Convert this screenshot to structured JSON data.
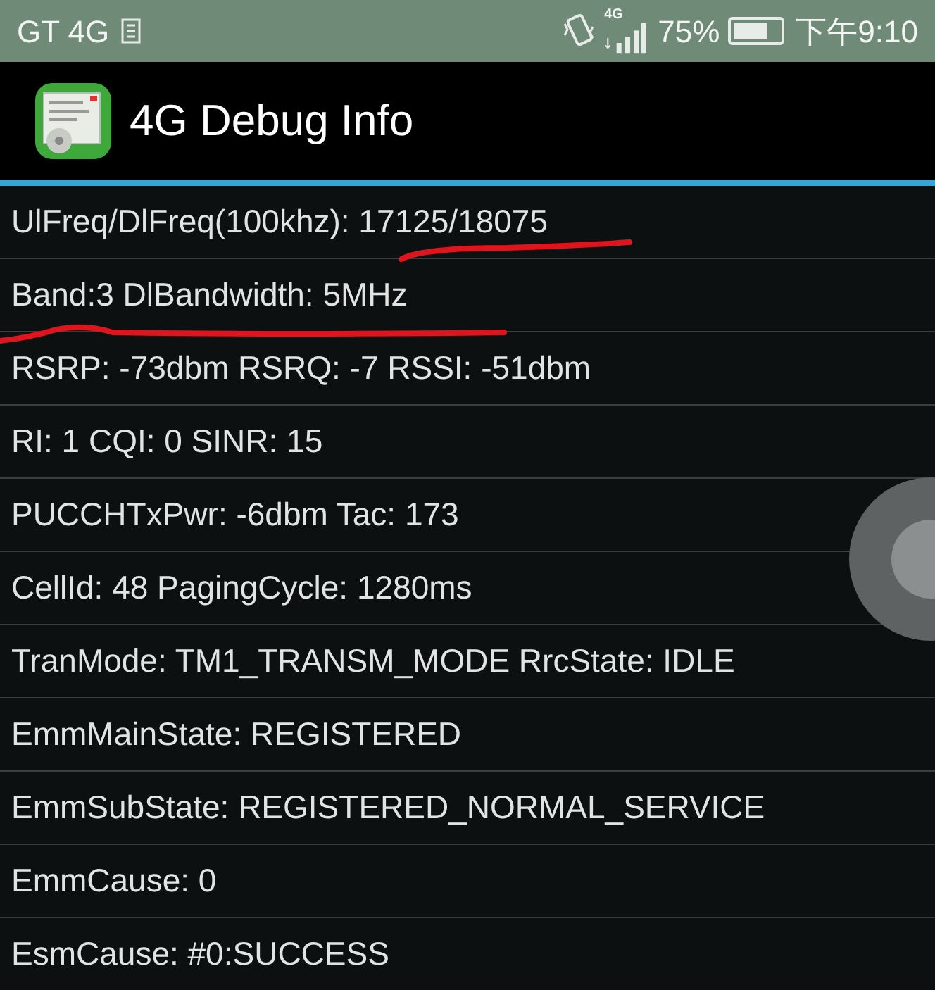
{
  "status_bar": {
    "carrier": "GT 4G",
    "network": "4G",
    "battery": "75%",
    "time": "下午9:10"
  },
  "action_bar": {
    "title": "4G Debug Info"
  },
  "rows": [
    {
      "text": "UlFreq/DlFreq(100khz): 17125/18075"
    },
    {
      "text": "Band:3 DlBandwidth: 5MHz"
    },
    {
      "text": "RSRP: -73dbm RSRQ: -7 RSSI: -51dbm"
    },
    {
      "text": "RI: 1 CQI: 0 SINR: 15"
    },
    {
      "text": "PUCCHTxPwr: -6dbm Tac: 173"
    },
    {
      "text": "CellId: 48 PagingCycle: 1280ms"
    },
    {
      "text": "TranMode: TM1_TRANSM_MODE RrcState: IDLE"
    },
    {
      "text": "EmmMainState: REGISTERED"
    },
    {
      "text": "EmmSubState: REGISTERED_NORMAL_SERVICE"
    },
    {
      "text": "EmmCause: 0"
    },
    {
      "text": "EsmCause: #0:SUCCESS"
    }
  ]
}
